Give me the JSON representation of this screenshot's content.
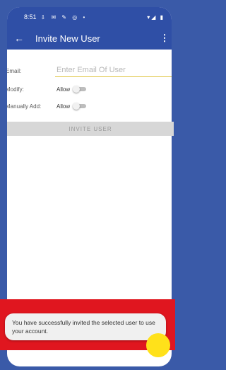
{
  "status_bar": {
    "time": "8:51",
    "icons_left": "⇩ ✉ ✎ ◎ •",
    "icons_right": "▾◢ ▮"
  },
  "app_bar": {
    "back_glyph": "←",
    "title": "Invite New User",
    "more_glyph": "⋮"
  },
  "form": {
    "email_label": "Email:",
    "email_placeholder": "Enter Email Of User",
    "email_value": "",
    "modify_label": "Modify:",
    "modify_allow": "Allow",
    "modify_enabled": false,
    "manual_label": "Manually Add:",
    "manual_allow": "Allow",
    "manual_enabled": false,
    "invite_button": "INVITE USER"
  },
  "toast": {
    "message": "You have successfully invited the selected user to use your account."
  },
  "colors": {
    "primary": "#2f4fa6",
    "highlight": "#e0161f",
    "fab": "#ffe11a"
  }
}
